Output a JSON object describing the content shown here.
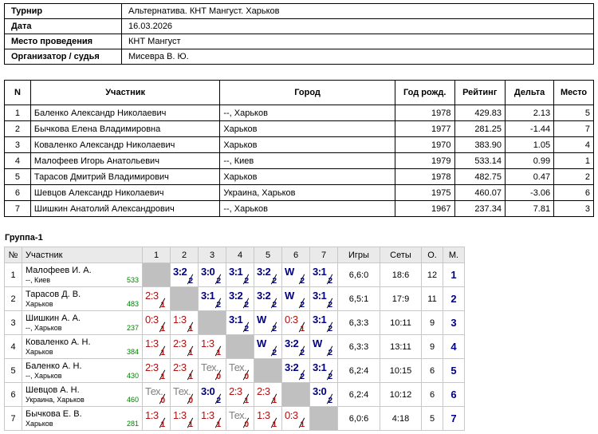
{
  "info": [
    {
      "label": "Турнир",
      "value": "Альтернатива. КНТ Мангуст. Харьков"
    },
    {
      "label": "Дата",
      "value": "16.03.2026"
    },
    {
      "label": "Место проведения",
      "value": "КНТ Мангуст"
    },
    {
      "label": "Организатор / судья",
      "value": "Мисевра В. Ю."
    }
  ],
  "participants": {
    "headers": [
      "N",
      "Участник",
      "Город",
      "Год рожд.",
      "Рейтинг",
      "Дельта",
      "Место"
    ],
    "rows": [
      [
        "1",
        "Баленко Александр Николаевич",
        "--, Харьков",
        "1978",
        "429.83",
        "2.13",
        "5"
      ],
      [
        "2",
        "Бычкова Елена Владимировна",
        "Харьков",
        "1977",
        "281.25",
        "-1.44",
        "7"
      ],
      [
        "3",
        "Коваленко Александр Николаевич",
        "Харьков",
        "1970",
        "383.90",
        "1.05",
        "4"
      ],
      [
        "4",
        "Малофеев Игорь Анатольевич",
        "--, Киев",
        "1979",
        "533.14",
        "0.99",
        "1"
      ],
      [
        "5",
        "Тарасов Дмитрий Владимирович",
        "Харьков",
        "1978",
        "482.75",
        "0.47",
        "2"
      ],
      [
        "6",
        "Шевцов Александр Николаевич",
        "Украина, Харьков",
        "1975",
        "460.07",
        "-3.06",
        "6"
      ],
      [
        "7",
        "Шишкин Анатолий Александрович",
        "--, Харьков",
        "1967",
        "237.34",
        "7.81",
        "3"
      ]
    ]
  },
  "group": {
    "title": "Группа-1",
    "headers": [
      "№",
      "Участник",
      "1",
      "2",
      "3",
      "4",
      "5",
      "6",
      "7",
      "Игры",
      "Сеты",
      "О.",
      "М."
    ],
    "rows": [
      {
        "n": "1",
        "name": "Малофеев И. А.",
        "city": "--, Киев",
        "rating": "533",
        "cells": [
          null,
          {
            "v": "3:2",
            "p": "2",
            "t": "win"
          },
          {
            "v": "3:0",
            "p": "2",
            "t": "win"
          },
          {
            "v": "3:1",
            "p": "2",
            "t": "win"
          },
          {
            "v": "3:2",
            "p": "2",
            "t": "win"
          },
          {
            "v": "W",
            "p": "2",
            "t": "win"
          },
          {
            "v": "3:1",
            "p": "2",
            "t": "win"
          }
        ],
        "games": "6,6:0",
        "sets": "18:6",
        "points": "12",
        "place": "1"
      },
      {
        "n": "2",
        "name": "Тарасов Д. В.",
        "city": "Харьков",
        "rating": "483",
        "cells": [
          {
            "v": "2:3",
            "p": "1",
            "t": "loss"
          },
          null,
          {
            "v": "3:1",
            "p": "2",
            "t": "win"
          },
          {
            "v": "3:2",
            "p": "2",
            "t": "win"
          },
          {
            "v": "3:2",
            "p": "2",
            "t": "win"
          },
          {
            "v": "W",
            "p": "2",
            "t": "win"
          },
          {
            "v": "3:1",
            "p": "2",
            "t": "win"
          }
        ],
        "games": "6,5:1",
        "sets": "17:9",
        "points": "11",
        "place": "2"
      },
      {
        "n": "3",
        "name": "Шишкин А. А.",
        "city": "--, Харьков",
        "rating": "237",
        "cells": [
          {
            "v": "0:3",
            "p": "1",
            "t": "loss"
          },
          {
            "v": "1:3",
            "p": "1",
            "t": "loss"
          },
          null,
          {
            "v": "3:1",
            "p": "2",
            "t": "win"
          },
          {
            "v": "W",
            "p": "2",
            "t": "win"
          },
          {
            "v": "0:3",
            "p": "1",
            "t": "loss"
          },
          {
            "v": "3:1",
            "p": "2",
            "t": "win"
          }
        ],
        "games": "6,3:3",
        "sets": "10:11",
        "points": "9",
        "place": "3"
      },
      {
        "n": "4",
        "name": "Коваленко А. Н.",
        "city": "Харьков",
        "rating": "384",
        "cells": [
          {
            "v": "1:3",
            "p": "1",
            "t": "loss"
          },
          {
            "v": "2:3",
            "p": "1",
            "t": "loss"
          },
          {
            "v": "1:3",
            "p": "1",
            "t": "loss"
          },
          null,
          {
            "v": "W",
            "p": "2",
            "t": "win"
          },
          {
            "v": "3:2",
            "p": "2",
            "t": "win"
          },
          {
            "v": "W",
            "p": "2",
            "t": "win"
          }
        ],
        "games": "6,3:3",
        "sets": "13:11",
        "points": "9",
        "place": "4"
      },
      {
        "n": "5",
        "name": "Баленко А. Н.",
        "city": "--, Харьков",
        "rating": "430",
        "cells": [
          {
            "v": "2:3",
            "p": "1",
            "t": "loss"
          },
          {
            "v": "2:3",
            "p": "1",
            "t": "loss"
          },
          {
            "v": "Тех.",
            "p": "0",
            "t": "tech"
          },
          {
            "v": "Тех.",
            "p": "0",
            "t": "tech"
          },
          null,
          {
            "v": "3:2",
            "p": "2",
            "t": "win"
          },
          {
            "v": "3:1",
            "p": "2",
            "t": "win"
          }
        ],
        "games": "6,2:4",
        "sets": "10:15",
        "points": "6",
        "place": "5"
      },
      {
        "n": "6",
        "name": "Шевцов А. Н.",
        "city": "Украина, Харьков",
        "rating": "460",
        "cells": [
          {
            "v": "Тех.",
            "p": "0",
            "t": "tech"
          },
          {
            "v": "Тех.",
            "p": "0",
            "t": "tech"
          },
          {
            "v": "3:0",
            "p": "2",
            "t": "win"
          },
          {
            "v": "2:3",
            "p": "1",
            "t": "loss"
          },
          {
            "v": "2:3",
            "p": "1",
            "t": "loss"
          },
          null,
          {
            "v": "3:0",
            "p": "2",
            "t": "win"
          }
        ],
        "games": "6,2:4",
        "sets": "10:12",
        "points": "6",
        "place": "6"
      },
      {
        "n": "7",
        "name": "Бычкова Е. В.",
        "city": "Харьков",
        "rating": "281",
        "cells": [
          {
            "v": "1:3",
            "p": "1",
            "t": "loss"
          },
          {
            "v": "1:3",
            "p": "1",
            "t": "loss"
          },
          {
            "v": "1:3",
            "p": "1",
            "t": "loss"
          },
          {
            "v": "Тех.",
            "p": "0",
            "t": "tech"
          },
          {
            "v": "1:3",
            "p": "1",
            "t": "loss"
          },
          {
            "v": "0:3",
            "p": "1",
            "t": "loss"
          },
          null
        ],
        "games": "6,0:6",
        "sets": "4:18",
        "points": "5",
        "place": "7"
      }
    ]
  }
}
